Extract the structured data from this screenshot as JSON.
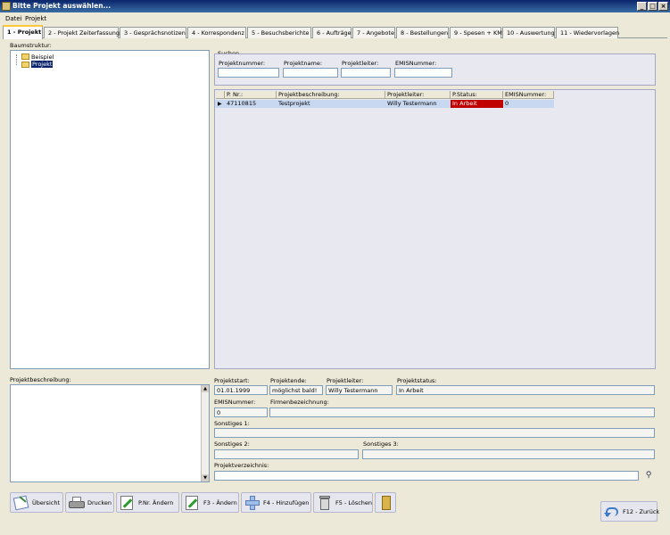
{
  "window": {
    "title": "Bitte Projekt auswählen...",
    "min": "_",
    "max": "□",
    "close": "×"
  },
  "menu": [
    "Datei",
    "Projekt"
  ],
  "tabs": [
    "1 - Projekt",
    "2 - Projekt Zeiterfassung",
    "3 - Gesprächsnotizen",
    "4 - Korrespondenz",
    "5 - Besuchsberichte",
    "6 - Aufträge",
    "7 - Angebote",
    "8 - Bestellungen",
    "9 - Spesen + KM",
    "10 - Auswertung",
    "11 - Wiedervorlagen"
  ],
  "tree": {
    "label": "Baumstruktur:",
    "items": [
      "Beispiel",
      "Projekt"
    ]
  },
  "search": {
    "label": "Suchen...",
    "fields": [
      "Projektnummer:",
      "Projektname:",
      "Projektleiter:",
      "EMISNummer:"
    ]
  },
  "grid": {
    "columns": [
      "P. Nr.:",
      "Projektbeschreibung:",
      "Projektleiter:",
      "P.Status:",
      "EMISNummer:"
    ],
    "rows": [
      [
        "47110815",
        "Testprojekt",
        "Willy Testermann",
        "In Arbeit",
        "0"
      ]
    ],
    "status_color": "#c00000"
  },
  "desc_label": "Projektbeschreibung:",
  "details": {
    "projektstart_label": "Projektstart:",
    "projektstart": "01.01.1999",
    "projektende_label": "Projektende:",
    "projektende": "möglichst bald!",
    "projektleiter_label": "Projektleiter:",
    "projektleiter": "Willy Testermann",
    "projektstatus_label": "Projektstatus:",
    "projektstatus": "In Arbeit",
    "emis_label": "EMISNummer:",
    "emis": "0",
    "firma_label": "Firmenbezeichnung:",
    "firma": "",
    "sonst1_label": "Sonstiges 1:",
    "sonst2_label": "Sonstiges 2:",
    "sonst3_label": "Sonstiges 3:",
    "verz_label": "Projektverzeichnis:"
  },
  "buttons": {
    "uebersicht": "Übersicht",
    "drucken": "Drucken",
    "pnr": "P.Nr. Ändern",
    "aendern": "F3 - Ändern",
    "hinzu": "F4 - Hinzufügen",
    "loeschen": "F5 - Löschen",
    "zurueck": "F12 - Zurück"
  }
}
